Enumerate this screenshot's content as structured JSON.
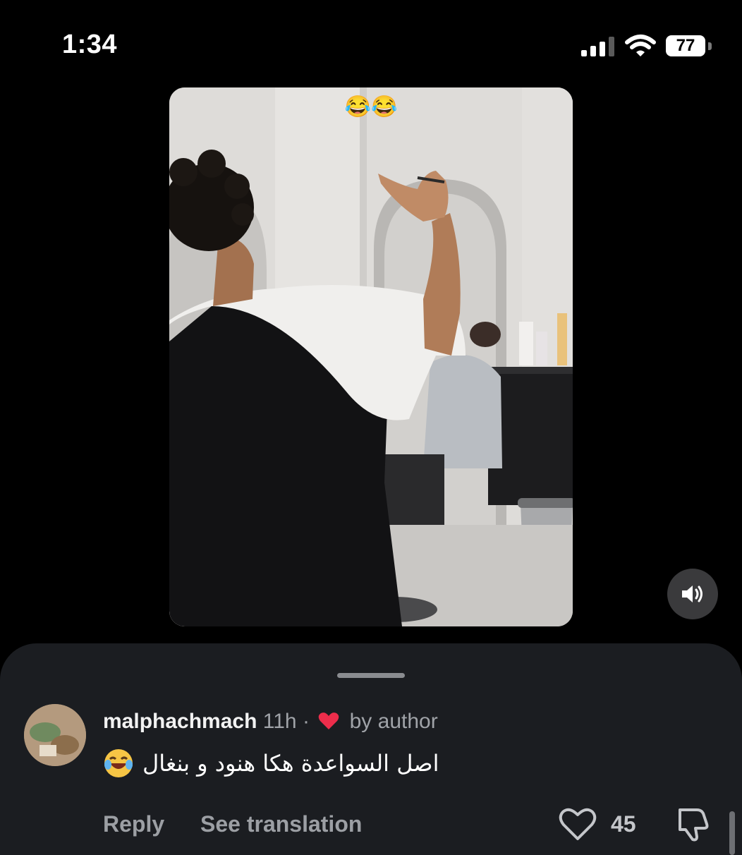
{
  "status_bar": {
    "time": "1:34",
    "battery_level": "77",
    "icons": [
      "signal-icon",
      "wifi-icon",
      "battery-icon"
    ]
  },
  "video": {
    "caption_emoji": "😂😂",
    "mute_icon": "speaker-icon"
  },
  "comment": {
    "username": "malphachmach",
    "time_ago": "11h",
    "separator": "·",
    "liked_by": "by author",
    "text_arabic": "اصل السواعدة هكا هنود و بنغال",
    "emoji": "😂",
    "reply_label": "Reply",
    "translate_label": "See translation",
    "like_count": "45",
    "colors": {
      "heart": "#ed2d4b",
      "muted_text": "#9c9fa4",
      "sheet_bg": "#1b1d21"
    }
  }
}
